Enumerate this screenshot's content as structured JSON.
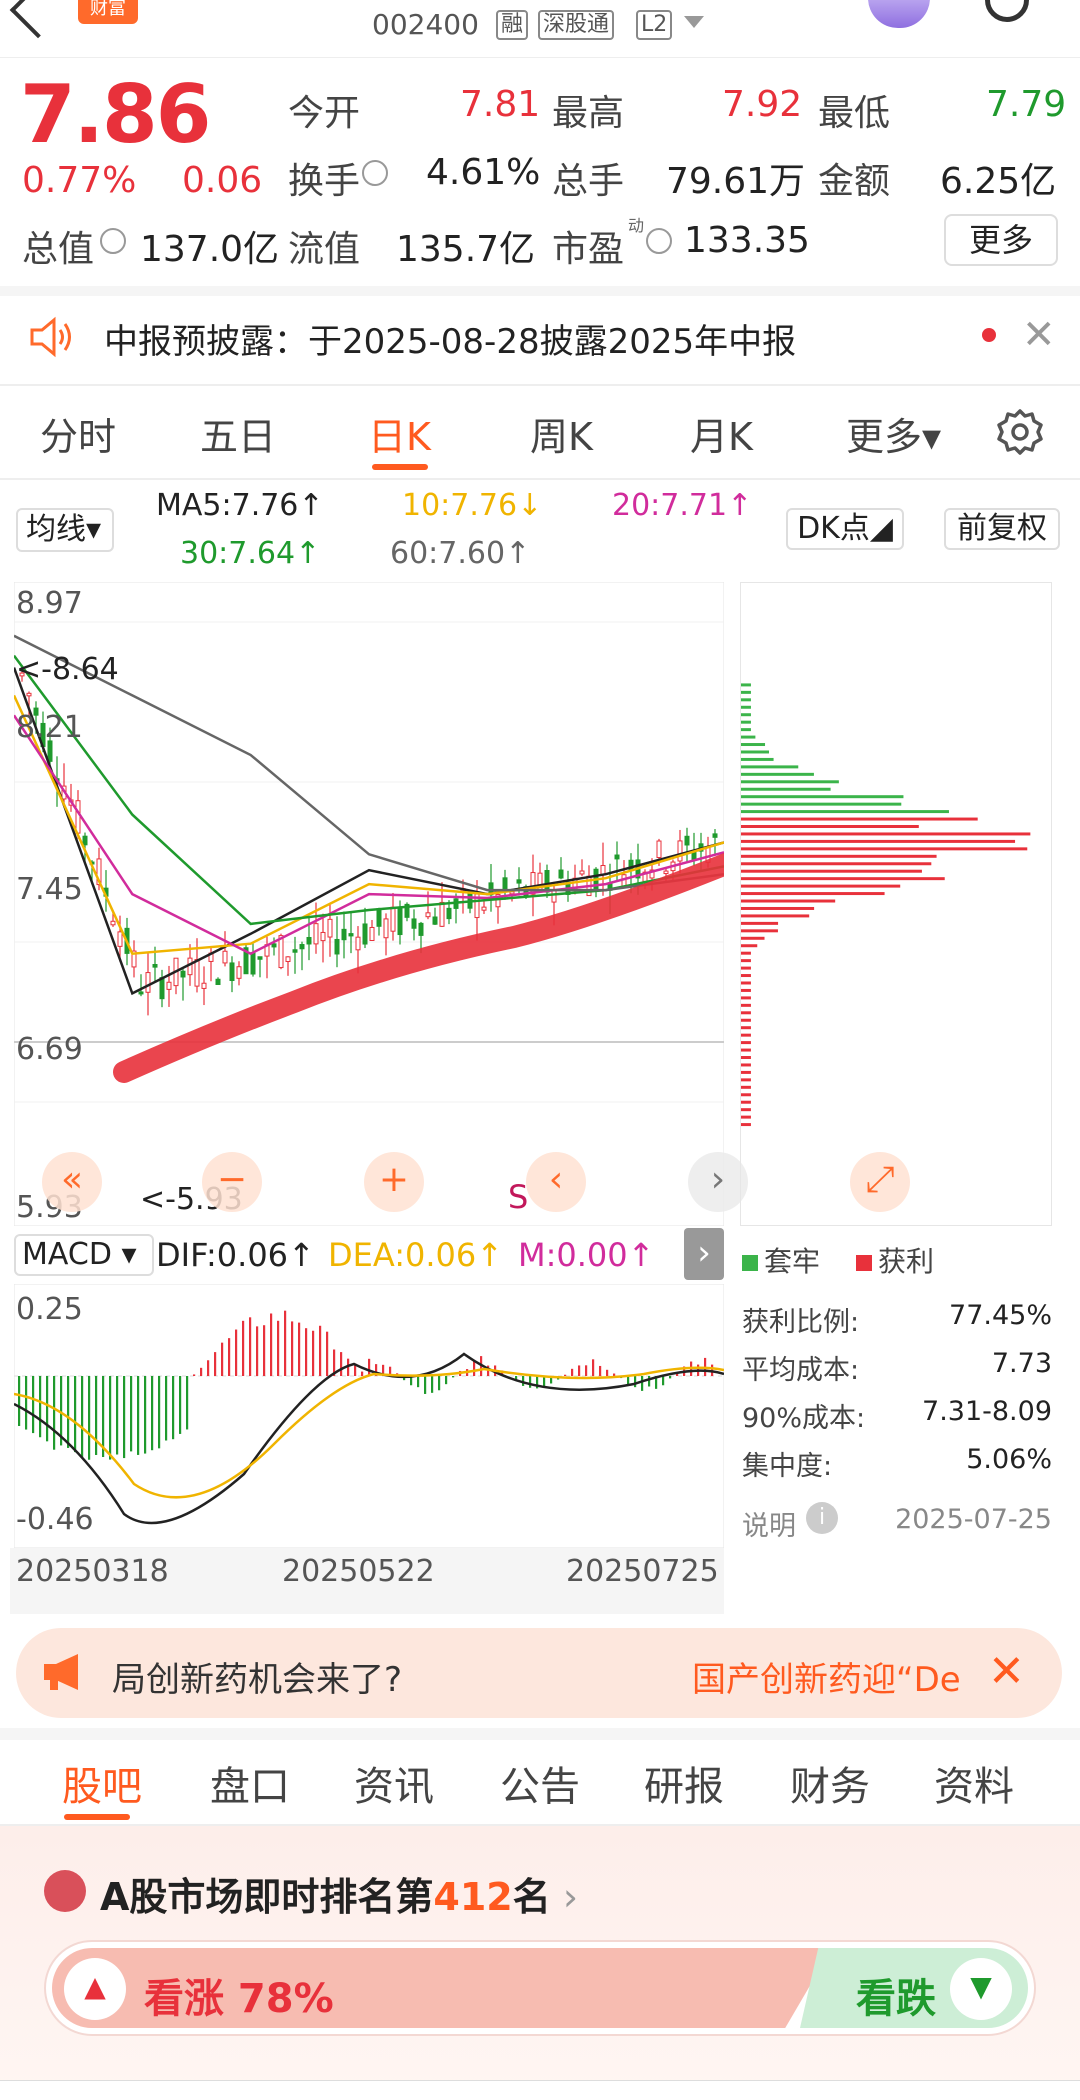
{
  "header": {
    "brand": "财富",
    "code": "002400",
    "tags": [
      "融",
      "深股通",
      "L2"
    ]
  },
  "quote": {
    "price": "7.86",
    "change_pct": "0.77%",
    "change": "0.06",
    "open_label": "今开",
    "open": "7.81",
    "high_label": "最高",
    "high": "7.92",
    "low_label": "最低",
    "low": "7.79",
    "turnover_label": "换手",
    "turnover": "4.61%",
    "volume_label": "总手",
    "volume": "79.61万",
    "amount_label": "金额",
    "amount": "6.25亿",
    "mktcap_label": "总值",
    "mktcap": "137.0亿",
    "float_label": "流值",
    "float_cap": "135.7亿",
    "pe_label": "市盈",
    "pe_sup": "动",
    "pe": "133.35",
    "more_label": "更多"
  },
  "notice": {
    "text": "中报预披露：于2025-08-28披露2025年中报",
    "close": "✕"
  },
  "period_tabs": [
    "分时",
    "五日",
    "日K",
    "周K",
    "月K",
    "更多▾"
  ],
  "ma": {
    "select": "均线▾",
    "ma5": "MA5:7.76↑",
    "ma10": "10:7.76↓",
    "ma20": "20:7.71↑",
    "ma30": "30:7.64↑",
    "ma60": "60:7.60↑",
    "dk": "DK点◢",
    "fq": "前复权",
    "colors": {
      "ma5": "#222222",
      "ma10": "#f0b400",
      "ma20": "#d12c9c",
      "ma30": "#1f9a2d",
      "ma60": "#666666"
    }
  },
  "kline": {
    "y_labels": [
      "8.97",
      "8.21",
      "7.45",
      "6.69",
      "5.93"
    ],
    "max_marker": "<-8.64",
    "min_marker": "<-5.93",
    "s_marker": "S"
  },
  "chart_data": {
    "type": "line",
    "title": "",
    "ylim": [
      5.93,
      8.97
    ],
    "x": [
      "20250318",
      "20250522",
      "20250725"
    ],
    "series": [
      {
        "name": "MA5",
        "values": [
          8.64,
          7.0,
          7.3,
          7.62,
          7.5,
          7.6,
          7.76
        ]
      },
      {
        "name": "MA10",
        "values": [
          8.5,
          7.2,
          7.25,
          7.55,
          7.5,
          7.58,
          7.76
        ]
      },
      {
        "name": "MA20",
        "values": [
          8.4,
          7.5,
          7.2,
          7.5,
          7.48,
          7.55,
          7.71
        ]
      },
      {
        "name": "MA30",
        "values": [
          8.7,
          7.9,
          7.35,
          7.42,
          7.47,
          7.52,
          7.64
        ]
      },
      {
        "name": "MA60",
        "values": [
          8.8,
          8.5,
          8.2,
          7.7,
          7.52,
          7.52,
          7.6
        ]
      }
    ]
  },
  "macd": {
    "select": "MACD ▾",
    "dif": "DIF:0.06↑",
    "dea": "DEA:0.06↑",
    "m": "M:0.00↑",
    "top": "0.25",
    "bottom": "-0.46",
    "dates": [
      "20250318",
      "20250522",
      "20250725"
    ]
  },
  "chips": {
    "legend_trap": "套牢",
    "legend_profit": "获利",
    "rows": [
      {
        "label": "获利比例:",
        "value": "77.45%"
      },
      {
        "label": "平均成本:",
        "value": "7.73"
      },
      {
        "label": "90%成本:",
        "value": "7.31-8.09"
      },
      {
        "label": "集中度:",
        "value": "5.06%"
      }
    ],
    "desc_label": "说明",
    "date": "2025-07-25"
  },
  "promo": {
    "text_a": "局创新药机会来了?",
    "text_b": "国产创新药迎“De",
    "close": "✕"
  },
  "bottom_tabs": [
    "股吧",
    "盘口",
    "资讯",
    "公告",
    "研报",
    "财务",
    "资料"
  ],
  "rank": {
    "prefix": "A股市场即时排名第",
    "number": "412",
    "suffix": "名"
  },
  "vote": {
    "up_label": "看涨 78%",
    "up_pct": 78,
    "down_label": "看跌"
  }
}
